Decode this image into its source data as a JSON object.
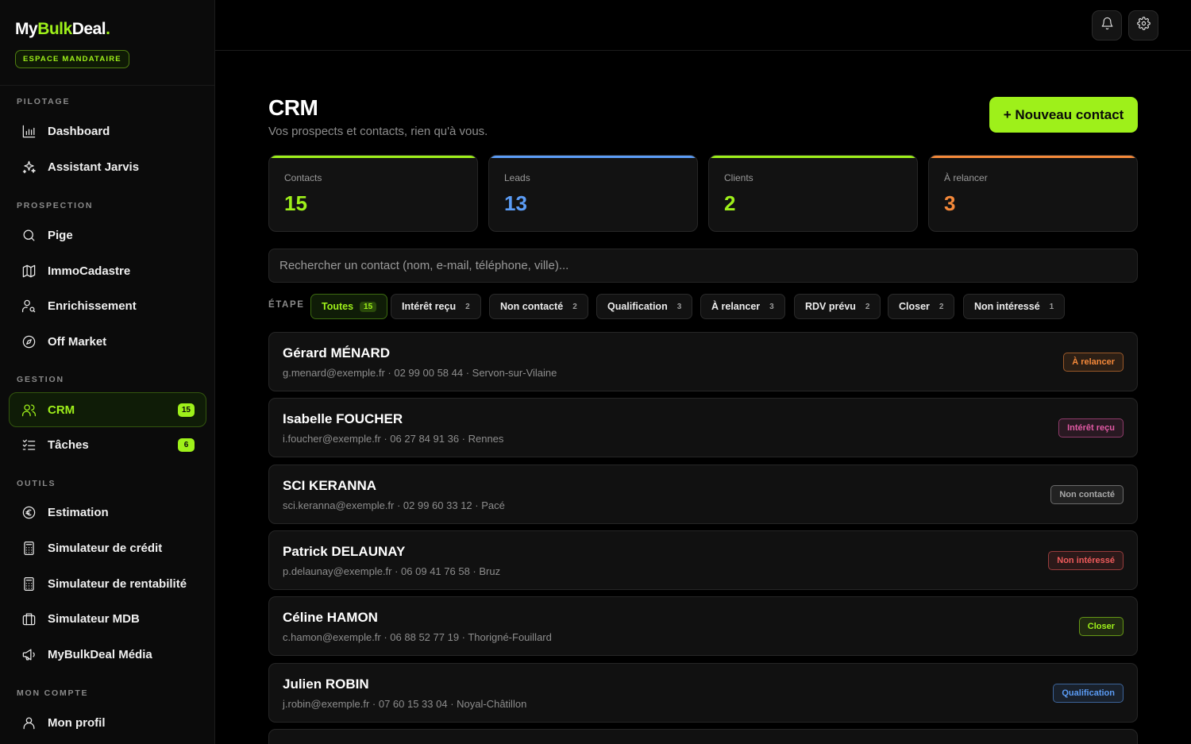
{
  "brand": {
    "logo_part1": "My",
    "logo_part2": "Bulk",
    "logo_part3": "Deal",
    "logo_dot": ".",
    "space_label": "ESPACE MANDATAIRE"
  },
  "sidebar": {
    "sections": {
      "pilotage": "PILOTAGE",
      "prospection": "PROSPECTION",
      "gestion": "GESTION",
      "outils": "OUTILS",
      "compte": "MON COMPTE"
    },
    "items": {
      "dashboard": "Dashboard",
      "jarvis": "Assistant Jarvis",
      "pige": "Pige",
      "immocadastre": "ImmoCadastre",
      "enrichissement": "Enrichissement",
      "offmarket": "Off Market",
      "crm": "CRM",
      "crm_badge": "15",
      "taches": "Tâches",
      "taches_badge": "6",
      "estimation": "Estimation",
      "credit": "Simulateur de crédit",
      "rentabilite": "Simulateur de rentabilité",
      "mdb": "Simulateur MDB",
      "media": "MyBulkDeal Média",
      "profil": "Mon profil"
    }
  },
  "header": {
    "notifications_icon": "bell-icon",
    "settings_icon": "gear-icon"
  },
  "main": {
    "title": "CRM",
    "subtitle": "Vos prospects et contacts, rien qu'à vous.",
    "new_button": "+ Nouveau contact",
    "stats": [
      {
        "label": "Contacts",
        "value": "15",
        "color": "#9ef01a"
      },
      {
        "label": "Leads",
        "value": "13",
        "color": "#5b9cf5"
      },
      {
        "label": "Clients",
        "value": "2",
        "color": "#9ef01a"
      },
      {
        "label": "À relancer",
        "value": "3",
        "color": "#f5893a"
      }
    ],
    "search_placeholder": "Rechercher un contact (nom, e-mail, téléphone, ville)...",
    "etape_label": "ÉTAPE",
    "filters": [
      {
        "label": "Toutes",
        "count": "15"
      },
      {
        "label": "Intérêt reçu",
        "count": "2"
      },
      {
        "label": "Non contacté",
        "count": "2"
      },
      {
        "label": "Qualification",
        "count": "3"
      },
      {
        "label": "À relancer",
        "count": "3"
      },
      {
        "label": "RDV prévu",
        "count": "2"
      },
      {
        "label": "Closer",
        "count": "2"
      },
      {
        "label": "Non intéressé",
        "count": "1"
      }
    ],
    "contacts": [
      {
        "name": "Gérard MÉNARD",
        "info": "g.menard@exemple.fr · 02 99 00 58 44 · Servon-sur-Vilaine",
        "stage": "À relancer",
        "stage_color": "#f5893a"
      },
      {
        "name": "Isabelle FOUCHER",
        "info": "i.foucher@exemple.fr · 06 27 84 91 36 · Rennes",
        "stage": "Intérêt reçu",
        "stage_color": "#e25aa5"
      },
      {
        "name": "SCI KERANNA",
        "info": "sci.keranna@exemple.fr · 02 99 60 33 12 · Pacé",
        "stage": "Non contacté",
        "stage_color": "#a8a8a8"
      },
      {
        "name": "Patrick DELAUNAY",
        "info": "p.delaunay@exemple.fr · 06 09 41 76 58 · Bruz",
        "stage": "Non intéressé",
        "stage_color": "#ef5b5b"
      },
      {
        "name": "Céline HAMON",
        "info": "c.hamon@exemple.fr · 06 88 52 77 19 · Thorigné-Fouillard",
        "stage": "Closer",
        "stage_color": "#9ef01a"
      },
      {
        "name": "Julien ROBIN",
        "info": "j.robin@exemple.fr · 07 60 15 33 04 · Noyal-Châtillon",
        "stage": "Qualification",
        "stage_color": "#5b9cf5"
      }
    ]
  }
}
